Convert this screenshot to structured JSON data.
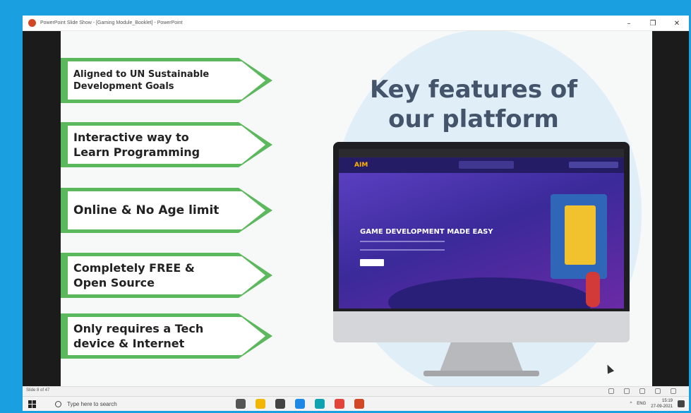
{
  "window": {
    "title": "PowerPoint Slide Show - [Gaming Module_Booklet] - PowerPoint",
    "minimize_glyph": "–",
    "restore_glyph": "❐",
    "close_glyph": "✕"
  },
  "slide": {
    "title": "Key features of our platform",
    "features": [
      "Aligned to UN Sustainable Development Goals",
      "Interactive way to Learn Programming",
      "Online & No Age limit",
      "Completely FREE & Open Source",
      "Only requires a Tech device & Internet"
    ],
    "monitor_screen": {
      "logo": "AIM",
      "headline": "GAME DEVELOPMENT MADE EASY"
    }
  },
  "statusbar": {
    "slide_counter": "Slide 8 of 47"
  },
  "taskbar": {
    "search_placeholder": "Type here to search",
    "language": "ENG",
    "time": "15:19",
    "date": "27-09-2021",
    "apps": [
      {
        "name": "task-view-icon",
        "color": "#555555"
      },
      {
        "name": "file-explorer-icon",
        "color": "#f2b705"
      },
      {
        "name": "mail-icon",
        "color": "#444444"
      },
      {
        "name": "calculator-icon",
        "color": "#1e88e5"
      },
      {
        "name": "edge-icon",
        "color": "#0fa3b1"
      },
      {
        "name": "chrome-icon",
        "color": "#e0443b"
      },
      {
        "name": "powerpoint-icon",
        "color": "#d24726"
      }
    ]
  },
  "colors": {
    "frame_blue": "#1a9fe0",
    "arrow_green": "#5cb85c",
    "title_slate": "#44546a",
    "circle_blue": "#dfeef7"
  }
}
